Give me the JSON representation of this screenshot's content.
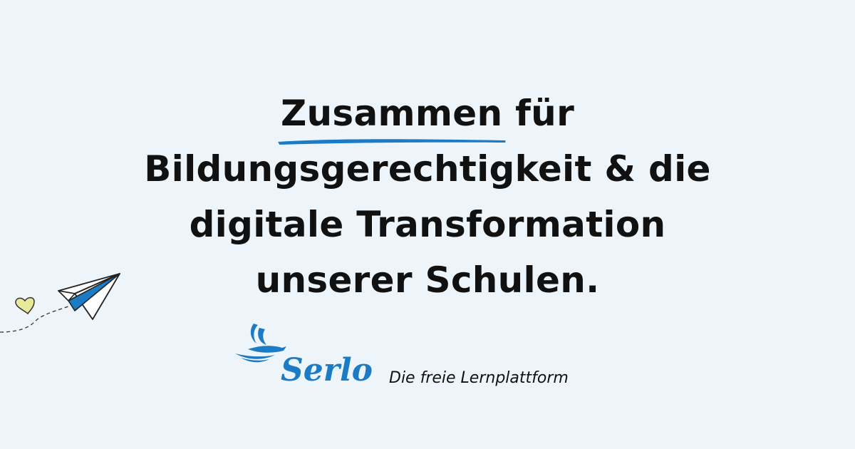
{
  "headline": {
    "emphasis": "Zusammen",
    "line1_rest": " für",
    "line2": "Bildungsgerechtigkeit & die",
    "line3": "digitale Transformation",
    "line4": "unserer Schulen."
  },
  "brand": {
    "name": "Serlo",
    "tagline": "Die freie Lernplattform"
  },
  "icons": {
    "plane": "paper-plane-icon",
    "heart": "heart-icon",
    "logo": "serlo-bird-logo"
  },
  "colors": {
    "background": "#eef5fa",
    "accent": "#1b7bc4",
    "heart": "#e6ea9a",
    "text": "#111111"
  }
}
